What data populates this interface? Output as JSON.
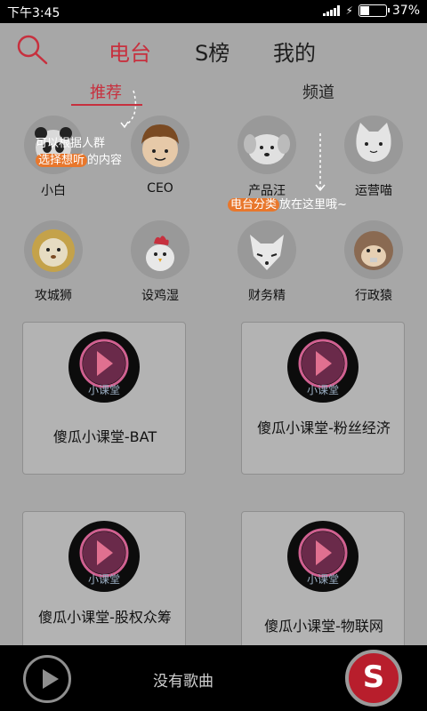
{
  "status_bar": {
    "time": "下午3:45",
    "battery": "37%",
    "battery_level": 0.37
  },
  "header": {
    "tabs": [
      {
        "label": "电台",
        "active": true
      },
      {
        "label": "S榜",
        "active": false
      },
      {
        "label": "我的",
        "active": false
      }
    ]
  },
  "subtabs": [
    {
      "label": "推荐",
      "active": true
    },
    {
      "label": "频道",
      "active": false
    }
  ],
  "categories": [
    {
      "label": "小白",
      "icon": "panda-icon"
    },
    {
      "label": "CEO",
      "icon": "boy-face-icon"
    },
    {
      "label": "产品汪",
      "icon": "dog-icon"
    },
    {
      "label": "运营喵",
      "icon": "cat-icon"
    },
    {
      "label": "攻城狮",
      "icon": "lion-icon"
    },
    {
      "label": "设鸡湿",
      "icon": "chicken-icon"
    },
    {
      "label": "财务精",
      "icon": "fox-icon"
    },
    {
      "label": "行政猿",
      "icon": "monkey-icon"
    }
  ],
  "cards": [
    {
      "title": "傻瓜小课堂-BAT",
      "logo_text": "小课堂"
    },
    {
      "title": "傻瓜小课堂-粉丝经济",
      "logo_text": "小课堂"
    },
    {
      "title": "傻瓜小课堂-股权众筹",
      "logo_text": "小课堂"
    },
    {
      "title": "傻瓜小课堂-物联网",
      "logo_text": "小课堂"
    }
  ],
  "annotations": {
    "note1_line1": "可以根据人群",
    "note1_hl": "选择想听",
    "note1_rest": "的内容",
    "note2_hl": "电台分类",
    "note2_rest": "放在这里哦~"
  },
  "player": {
    "status": "没有歌曲",
    "brand_letter": "S"
  },
  "colors": {
    "accent": "#c7303e",
    "brand": "#b81e2c",
    "highlight": "#e8772c"
  }
}
